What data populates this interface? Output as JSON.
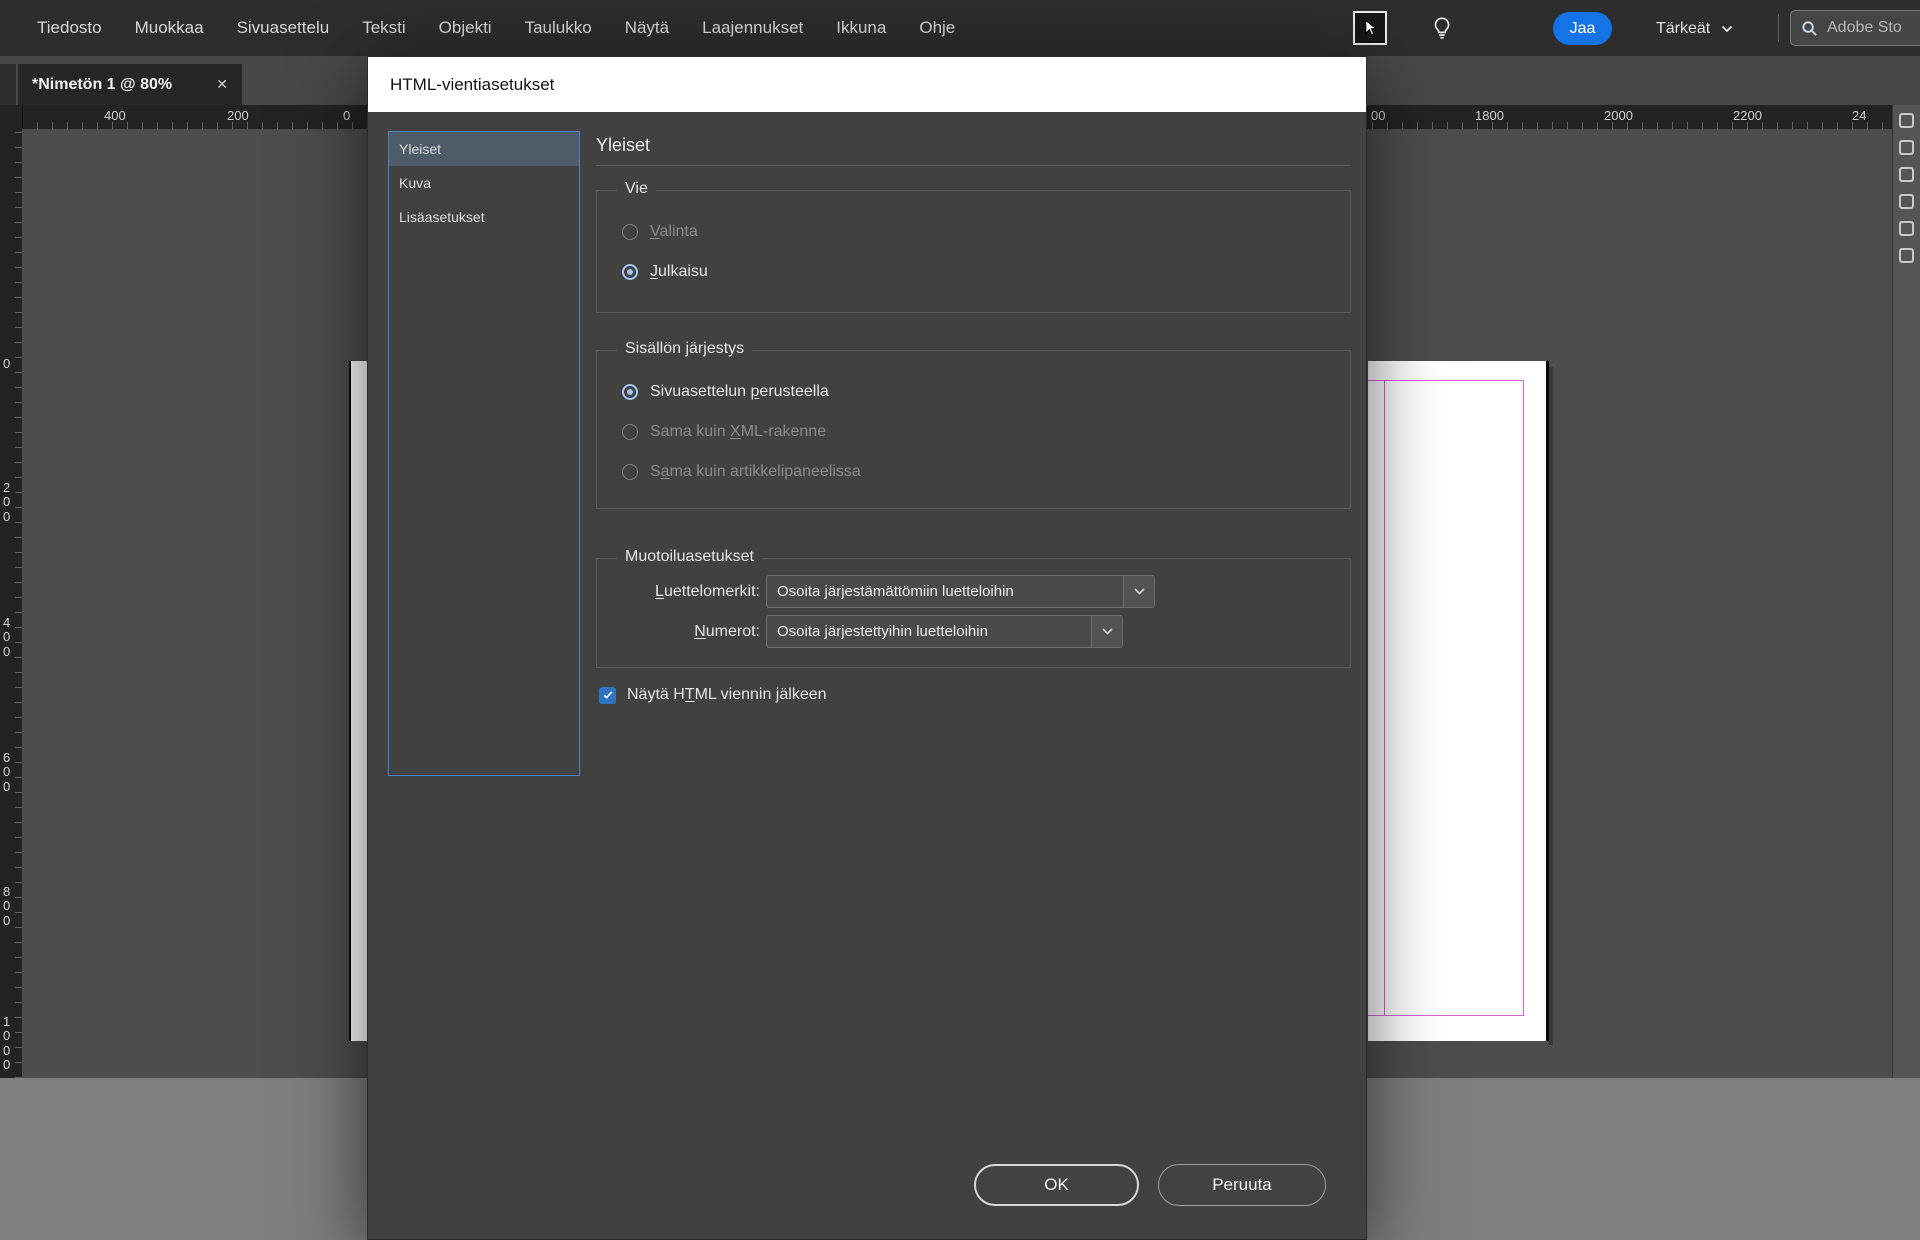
{
  "colors": {
    "accent_blue": "#1473e6",
    "list_border_blue": "#4c86c4",
    "radio_selected_blue": "#a4c6ec",
    "checkbox_blue": "#2f74c0",
    "margin_guide_magenta": "#d365d3"
  },
  "menubar": {
    "items": [
      "Tiedosto",
      "Muokkaa",
      "Sivuasettelu",
      "Teksti",
      "Objekti",
      "Taulukko",
      "Näytä",
      "Laajennukset",
      "Ikkuna",
      "Ohje"
    ],
    "share_button": "Jaa",
    "workspace_switcher": "Tärkeät",
    "search_text": "Adobe Sto"
  },
  "tab": {
    "title": "*Nimetön 1 @ 80%",
    "close": "✕"
  },
  "ruler": {
    "h_left": [
      "400",
      "200",
      "0"
    ],
    "h_right": [
      "00",
      "1800",
      "2000",
      "2200",
      "24"
    ],
    "v": [
      "0",
      "200",
      "400",
      "600",
      "800",
      "1000"
    ]
  },
  "dialog": {
    "title": "HTML-vientiasetukset",
    "sidebar": {
      "items": [
        "Yleiset",
        "Kuva",
        "Lisäasetukset"
      ],
      "selected": "Yleiset"
    },
    "heading": "Yleiset",
    "vie": {
      "legend": "Vie",
      "options": [
        {
          "pre": "",
          "key": "V",
          "post": "alinta",
          "state": "disabled",
          "selected": false
        },
        {
          "pre": "",
          "key": "J",
          "post": "ulkaisu",
          "state": "enabled",
          "selected": true
        }
      ]
    },
    "jarjestys": {
      "legend": "Sisällön järjestys",
      "options": [
        {
          "pre": "Sivuasettelun ",
          "key": "p",
          "post": "erusteella",
          "state": "enabled",
          "selected": true
        },
        {
          "pre": "Sama kuin ",
          "key": "X",
          "post": "ML-rakenne",
          "state": "disabled",
          "selected": false
        },
        {
          "pre": "S",
          "key": "a",
          "post": "ma kuin artikkelipaneelissa",
          "state": "disabled",
          "selected": false
        }
      ]
    },
    "muotoilu": {
      "legend": "Muotoiluasetukset",
      "rows": [
        {
          "label_pre": "",
          "label_key": "L",
          "label_post": "uettelomerkit:",
          "value": "Osoita järjestämättömiin luetteloihin"
        },
        {
          "label_pre": "",
          "label_key": "N",
          "label_post": "umerot:",
          "value": "Osoita järjestettyihin luetteloihin"
        }
      ]
    },
    "show_after_export": {
      "pre": "Näytä H",
      "key": "T",
      "post": "ML viennin jälkeen",
      "checked": true
    },
    "buttons": {
      "ok": "OK",
      "cancel": "Peruuta"
    }
  }
}
